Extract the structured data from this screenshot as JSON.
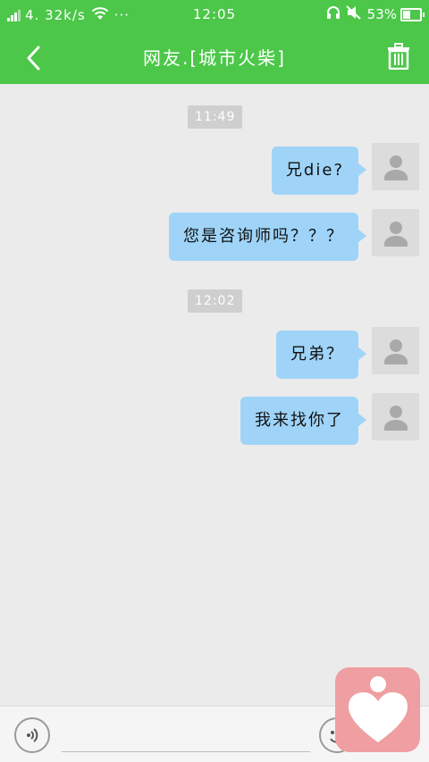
{
  "status_bar": {
    "net_speed": "4. 32k/s",
    "more_indicator": "···",
    "time": "12:05",
    "battery_percent": "53%",
    "battery_level": 0.53,
    "icons": [
      "signal-icon",
      "wifi-icon",
      "headset-icon",
      "mute-icon",
      "battery-icon"
    ]
  },
  "header": {
    "title": "网友.[城市火柴]",
    "back_icon": "back-arrow-icon",
    "delete_icon": "trash-icon"
  },
  "conversation": {
    "groups": [
      {
        "timestamp": "11:49",
        "messages": [
          "兄die?",
          "您是咨询师吗？？？"
        ]
      },
      {
        "timestamp": "12:02",
        "messages": [
          "兄弟？",
          "我来找你了"
        ]
      }
    ]
  },
  "input_bar": {
    "voice_icon": "voice-icon",
    "input_value": "",
    "emoji_icon": "emoji-icon"
  },
  "floating": {
    "icon": "heart-icon"
  },
  "colors": {
    "header_green": "#4cc749",
    "bubble_blue": "#9fd4f8",
    "background": "#ebebeb",
    "heart_button": "#ef9ea1"
  }
}
